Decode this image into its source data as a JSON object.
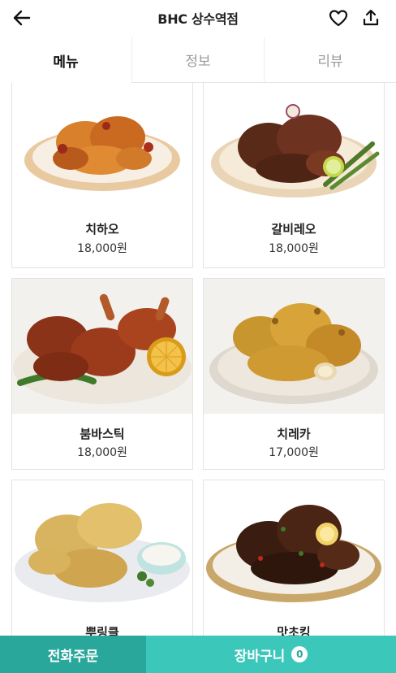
{
  "header": {
    "title": "BHC 상수역점",
    "back_icon": "arrow-left-icon",
    "favorite_icon": "heart-icon",
    "share_icon": "share-icon"
  },
  "tabs": [
    {
      "label": "메뉴",
      "active": true
    },
    {
      "label": "정보",
      "active": false
    },
    {
      "label": "리뷰",
      "active": false
    }
  ],
  "menu": [
    {
      "name": "치하오",
      "price": "18,000원"
    },
    {
      "name": "갈비레오",
      "price": "18,000원"
    },
    {
      "name": "붐바스틱",
      "price": "18,000원"
    },
    {
      "name": "치레카",
      "price": "17,000원"
    },
    {
      "name": "뿌링클",
      "price": ""
    },
    {
      "name": "맛초킹",
      "price": ""
    }
  ],
  "bottom": {
    "phone_order": "전화주문",
    "cart": "장바구니",
    "cart_count": "0"
  },
  "colors": {
    "phone_button": "#2aa79b",
    "cart_button": "#3cc7bb"
  }
}
